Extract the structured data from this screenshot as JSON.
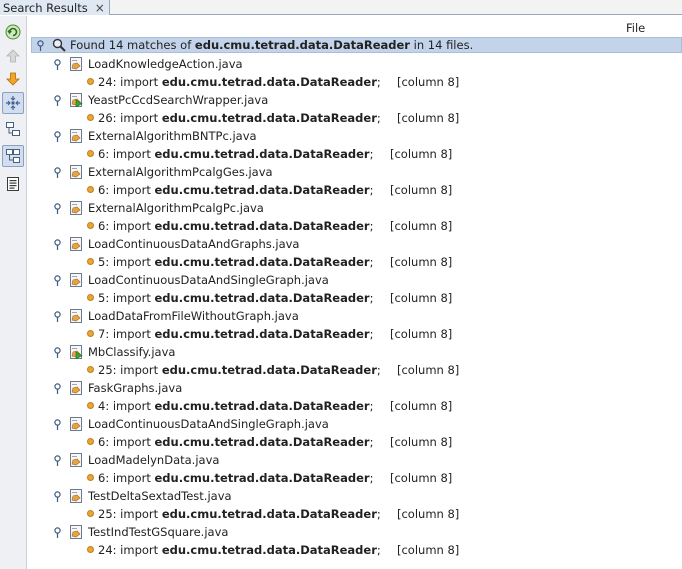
{
  "tab": {
    "title": "Search Results",
    "close": "×"
  },
  "toolbar": {
    "buttons": [
      {
        "name": "refresh-button",
        "icon": "refresh-icon"
      },
      {
        "name": "previous-match-button",
        "icon": "arrow-up-icon"
      },
      {
        "name": "next-match-button",
        "icon": "arrow-down-icon"
      },
      {
        "name": "expand-collapse-button",
        "icon": "expand-icon"
      },
      {
        "name": "show-details-button",
        "icon": "tree-icon"
      },
      {
        "name": "logical-view-button",
        "icon": "logical-view-icon"
      },
      {
        "name": "save-results-button",
        "icon": "save-icon"
      }
    ]
  },
  "columns": {
    "file": "File"
  },
  "summary": {
    "prefix": "Found 14 matches of ",
    "query": "edu.cmu.tetrad.data.DataReader",
    "suffix": " in 14 files."
  },
  "files": [
    {
      "name": "LoadKnowledgeAction.java",
      "icon_variant": "java",
      "line": "24:",
      "import_kw": "import",
      "match": "edu.cmu.tetrad.data.DataReader",
      "semi": ";",
      "column": "[column 8]"
    },
    {
      "name": "YeastPcCcdSearchWrapper.java",
      "icon_variant": "java-runnable",
      "line": "26:",
      "import_kw": "import",
      "match": "edu.cmu.tetrad.data.DataReader",
      "semi": ";",
      "column": "[column 8]"
    },
    {
      "name": "ExternalAlgorithmBNTPc.java",
      "icon_variant": "java",
      "line": "6:",
      "import_kw": "import",
      "match": "edu.cmu.tetrad.data.DataReader",
      "semi": ";",
      "column": "[column 8]"
    },
    {
      "name": "ExternalAlgorithmPcalgGes.java",
      "icon_variant": "java",
      "line": "6:",
      "import_kw": "import",
      "match": "edu.cmu.tetrad.data.DataReader",
      "semi": ";",
      "column": "[column 8]"
    },
    {
      "name": "ExternalAlgorithmPcalgPc.java",
      "icon_variant": "java",
      "line": "6:",
      "import_kw": "import",
      "match": "edu.cmu.tetrad.data.DataReader",
      "semi": ";",
      "column": "[column 8]"
    },
    {
      "name": "LoadContinuousDataAndGraphs.java",
      "icon_variant": "java",
      "line": "5:",
      "import_kw": "import",
      "match": "edu.cmu.tetrad.data.DataReader",
      "semi": ";",
      "column": "[column 8]"
    },
    {
      "name": "LoadContinuousDataAndSingleGraph.java",
      "icon_variant": "java",
      "line": "5:",
      "import_kw": "import",
      "match": "edu.cmu.tetrad.data.DataReader",
      "semi": ";",
      "column": "[column 8]"
    },
    {
      "name": "LoadDataFromFileWithoutGraph.java",
      "icon_variant": "java",
      "line": "7:",
      "import_kw": "import",
      "match": "edu.cmu.tetrad.data.DataReader",
      "semi": ";",
      "column": "[column 8]"
    },
    {
      "name": "MbClassify.java",
      "icon_variant": "java-runnable",
      "line": "25:",
      "import_kw": "import",
      "match": "edu.cmu.tetrad.data.DataReader",
      "semi": ";",
      "column": "[column 8]"
    },
    {
      "name": "FaskGraphs.java",
      "icon_variant": "java",
      "line": "4:",
      "import_kw": "import",
      "match": "edu.cmu.tetrad.data.DataReader",
      "semi": ";",
      "column": "[column 8]"
    },
    {
      "name": "LoadContinuousDataAndSingleGraph.java",
      "icon_variant": "java",
      "line": "6:",
      "import_kw": "import",
      "match": "edu.cmu.tetrad.data.DataReader",
      "semi": ";",
      "column": "[column 8]"
    },
    {
      "name": "LoadMadelynData.java",
      "icon_variant": "java",
      "line": "6:",
      "import_kw": "import",
      "match": "edu.cmu.tetrad.data.DataReader",
      "semi": ";",
      "column": "[column 8]"
    },
    {
      "name": "TestDeltaSextadTest.java",
      "icon_variant": "java",
      "line": "25:",
      "import_kw": "import",
      "match": "edu.cmu.tetrad.data.DataReader",
      "semi": ";",
      "column": "[column 8]"
    },
    {
      "name": "TestIndTestGSquare.java",
      "icon_variant": "java",
      "line": "24:",
      "import_kw": "import",
      "match": "edu.cmu.tetrad.data.DataReader",
      "semi": ";",
      "column": "[column 8]"
    }
  ],
  "colors": {
    "root_highlight": "#c3d4ea",
    "match_dot": "#e8a53a",
    "toolbar_pressed": "#d2def0"
  }
}
